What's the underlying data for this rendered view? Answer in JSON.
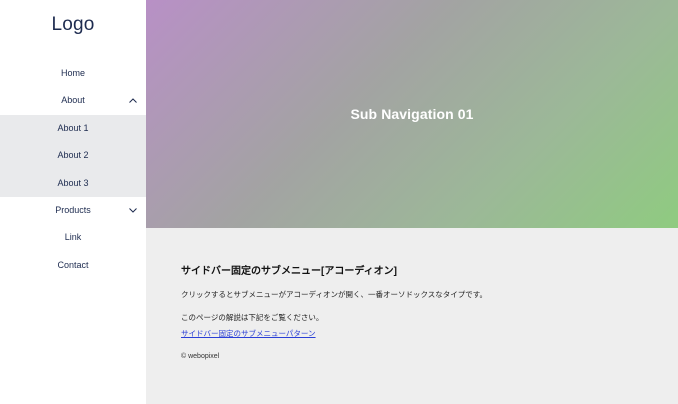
{
  "sidebar": {
    "logo": "Logo",
    "items": [
      {
        "label": "Home"
      },
      {
        "label": "About",
        "expanded": true,
        "children": [
          {
            "label": "About 1"
          },
          {
            "label": "About 2"
          },
          {
            "label": "About 3"
          }
        ]
      },
      {
        "label": "Products",
        "expanded": false
      },
      {
        "label": "Link"
      },
      {
        "label": "Contact"
      }
    ]
  },
  "hero": {
    "title": "Sub Navigation 01"
  },
  "content": {
    "heading": "サイドバー固定のサブメニュー[アコーディオン]",
    "description": "クリックするとサブメニューがアコーディオンが開く、一番オーソドックスなタイプです。",
    "note": "このページの解説は下記をご覧ください。",
    "link_label": "サイドバー固定のサブメニューパターン",
    "copyright": "© webopixel"
  },
  "colors": {
    "nav_text": "#1d2b4f",
    "submenu_bg": "#e9eaec",
    "content_bg": "#eeeeee",
    "link": "#2a3fd6",
    "hero_gradient_start": "#b890c6",
    "hero_gradient_end": "#8fcb80"
  },
  "icons": {
    "about_toggle": "chevron-up-icon",
    "products_toggle": "chevron-down-icon"
  }
}
